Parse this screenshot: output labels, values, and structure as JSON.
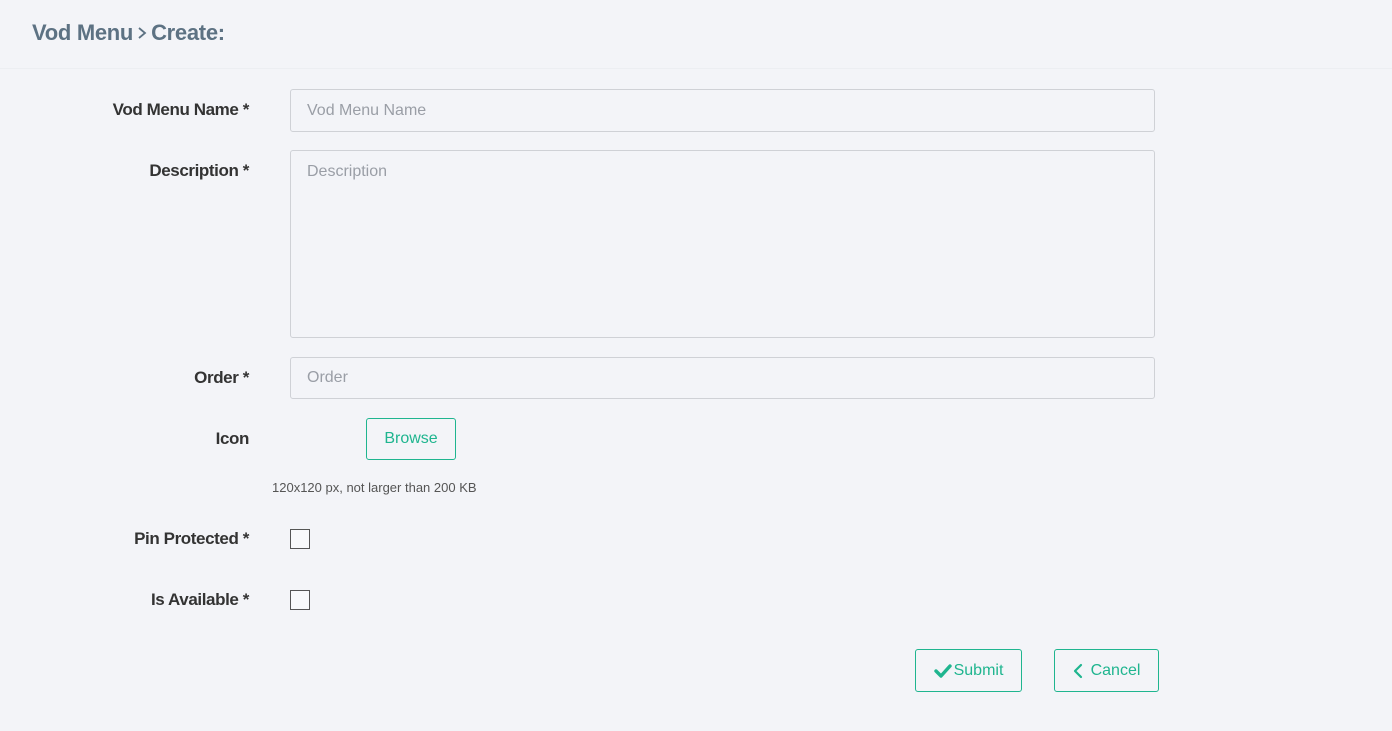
{
  "breadcrumb": {
    "parent": "Vod Menu",
    "current": "Create:"
  },
  "form": {
    "name": {
      "label": "Vod Menu Name *",
      "placeholder": "Vod Menu Name",
      "value": ""
    },
    "description": {
      "label": "Description *",
      "placeholder": "Description",
      "value": ""
    },
    "order": {
      "label": "Order *",
      "placeholder": "Order",
      "value": ""
    },
    "icon": {
      "label": "Icon",
      "browse_label": "Browse",
      "hint": "120x120 px, not larger than 200 KB"
    },
    "pin_protected": {
      "label": "Pin Protected *",
      "checked": false
    },
    "is_available": {
      "label": "Is Available *",
      "checked": false
    }
  },
  "actions": {
    "submit_label": "Submit",
    "cancel_label": "Cancel",
    "submit_icon": "check-icon",
    "cancel_icon": "chevron-left-icon"
  },
  "colors": {
    "accent": "#1fb58f",
    "breadcrumb": "#5d7283",
    "background": "#f3f4f8"
  }
}
